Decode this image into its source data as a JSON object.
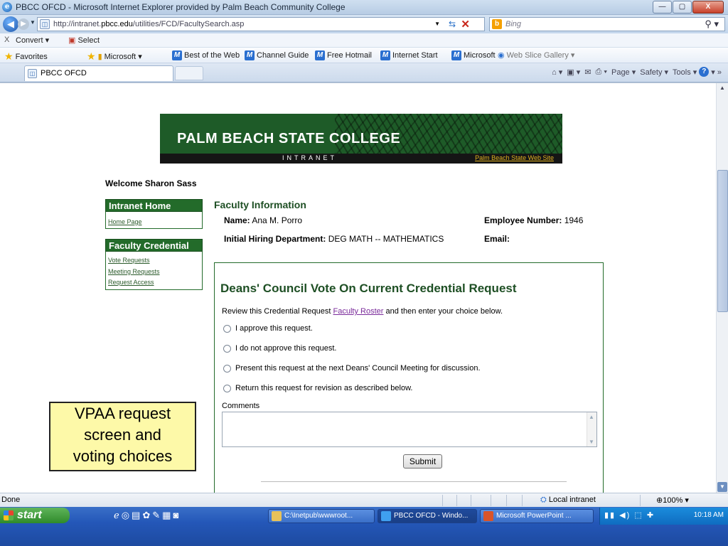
{
  "window": {
    "title": "PBCC OFCD - Microsoft Internet Explorer provided by Palm Beach Community College",
    "url_prefix": "http://intranet.",
    "url_host": "pbcc.edu",
    "url_path": "/utilities/FCD/FacultySearch.asp",
    "search_engine": "Bing",
    "min": "—",
    "max": "▢",
    "close": "X"
  },
  "convertbar": {
    "close": "X",
    "convert": "Convert ▾",
    "select": "Select"
  },
  "favorites": {
    "favorites_label": "Favorites",
    "items": [
      "Microsoft ▾",
      "Best of the Web",
      "Channel Guide",
      "Free Hotmail",
      "Internet Start",
      "Microsoft",
      "Web Slice Gallery ▾"
    ]
  },
  "tab": {
    "label": "PBCC OFCD"
  },
  "commands": {
    "page": "Page ▾",
    "safety": "Safety ▾",
    "tools": "Tools ▾"
  },
  "banner": {
    "name": "PALM BEACH STATE COLLEGE",
    "intranet": "INTRANET",
    "web_site": "Palm Beach State Web Site"
  },
  "welcome": "Welcome Sharon Sass",
  "sidebar": {
    "intranet_home": {
      "heading": "Intranet Home",
      "links": [
        "Home Page"
      ]
    },
    "faculty_credential": {
      "heading": "Faculty Credential",
      "links": [
        "Vote Requests",
        "Meeting Requests",
        "Request Access"
      ]
    }
  },
  "faculty": {
    "title": "Faculty Information",
    "name_label": "Name:",
    "name": "Ana M. Porro",
    "emp_label": "Employee Number:",
    "emp_number": "1946",
    "dept_label": "Initial Hiring Department:",
    "dept": "DEG MATH -- MATHEMATICS",
    "email_label": "Email:",
    "email": ""
  },
  "vote": {
    "title": "Deans' Council Vote On Current Credential Request",
    "review_before": "Review this Credential Request ",
    "review_link": "Faculty Roster",
    "review_after": " and then enter your choice below.",
    "options": [
      "I approve this request.",
      "I do not approve this request.",
      "Present this request at the next Deans' Council Meeting for discussion.",
      "Return this request for revision as described below."
    ],
    "comments_label": "Comments",
    "comments_value": "",
    "submit": "Submit"
  },
  "callout": {
    "lines": [
      "VPAA request",
      "screen and",
      "voting choices"
    ]
  },
  "status": {
    "done": "Done",
    "zone": "Local intranet",
    "zoom": "100%"
  },
  "taskbar": {
    "start": "start",
    "tasks": [
      "C:\\Inetpub\\wwwroot...",
      "PBCC OFCD - Windo...",
      "Microsoft PowerPoint ..."
    ],
    "clock": "10:18 AM"
  },
  "colors": {
    "brand_green": "#236b2a",
    "link_visited": "#7a2a9a",
    "callout_bg": "#fdf9a8"
  }
}
